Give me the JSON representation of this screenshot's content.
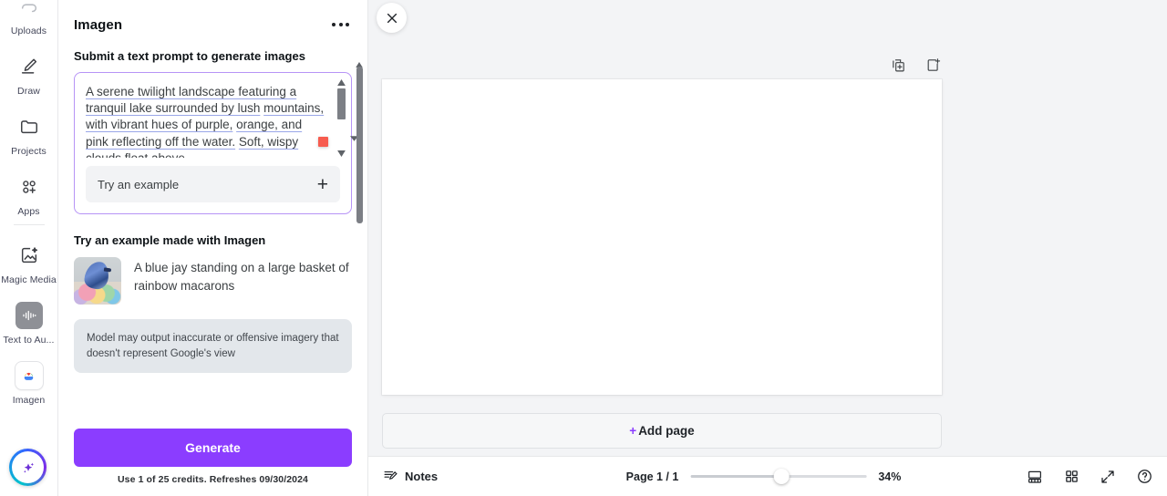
{
  "sidebar": {
    "items": [
      {
        "label": "Uploads",
        "icon": "uploads-icon"
      },
      {
        "label": "Draw",
        "icon": "draw-icon"
      },
      {
        "label": "Projects",
        "icon": "folder-icon"
      },
      {
        "label": "Apps",
        "icon": "apps-grid-plus-icon"
      },
      {
        "label": "Magic Media",
        "icon": "magic-media-icon"
      },
      {
        "label": "Text to Au...",
        "icon": "audio-waveform-icon"
      },
      {
        "label": "Imagen",
        "icon": "google-cloud-icon"
      }
    ],
    "magic_button": "magic-studio-sparkle-button"
  },
  "panel": {
    "title": "Imagen",
    "more_menu": "more-options",
    "prompt_section_label": "Submit a text prompt to generate images",
    "prompt_value": "A serene twilight landscape featuring a tranquil lake surrounded by lush mountains, with vibrant hues of purple, orange, and pink reflecting off the water. Soft, wispy clouds float above",
    "prompt_line_1": "A serene twilight landscape featuring a",
    "prompt_line_2": "tranquil lake surrounded by lush",
    "prompt_line_3": "mountains, with vibrant hues of purple,",
    "prompt_line_4": "orange, and pink reflecting off the water.",
    "prompt_line_5": "Soft, wispy clouds float above",
    "try_example_button": "Try an example",
    "add_icon": "plus-icon",
    "examples_label": "Try an example made with Imagen",
    "example_item": "A blue jay standing on a large basket of rainbow macarons",
    "notice": "Model may output inaccurate or offensive imagery that doesn't represent Google's view",
    "generate_label": "Generate",
    "credits": "Use 1 of 25 credits. Refreshes 09/30/2024",
    "accent_color": "#8b3dff",
    "prompt_border_color": "#b794f6",
    "marker_color": "#f75c4f"
  },
  "canvas": {
    "close_icon": "close-icon",
    "duplicate_page_icon": "duplicate-page-icon",
    "add_page_icon": "add-page-icon",
    "add_page_label": "Add page",
    "add_page_plus": "+"
  },
  "bottombar": {
    "notes_label": "Notes",
    "notes_icon": "notes-icon",
    "page_indicator": "Page 1 / 1",
    "zoom_level": "34%",
    "presenter_icon": "presenter-view-icon",
    "grid_icon": "grid-view-icon",
    "fullscreen_icon": "fullscreen-icon",
    "help_icon": "help-icon"
  }
}
